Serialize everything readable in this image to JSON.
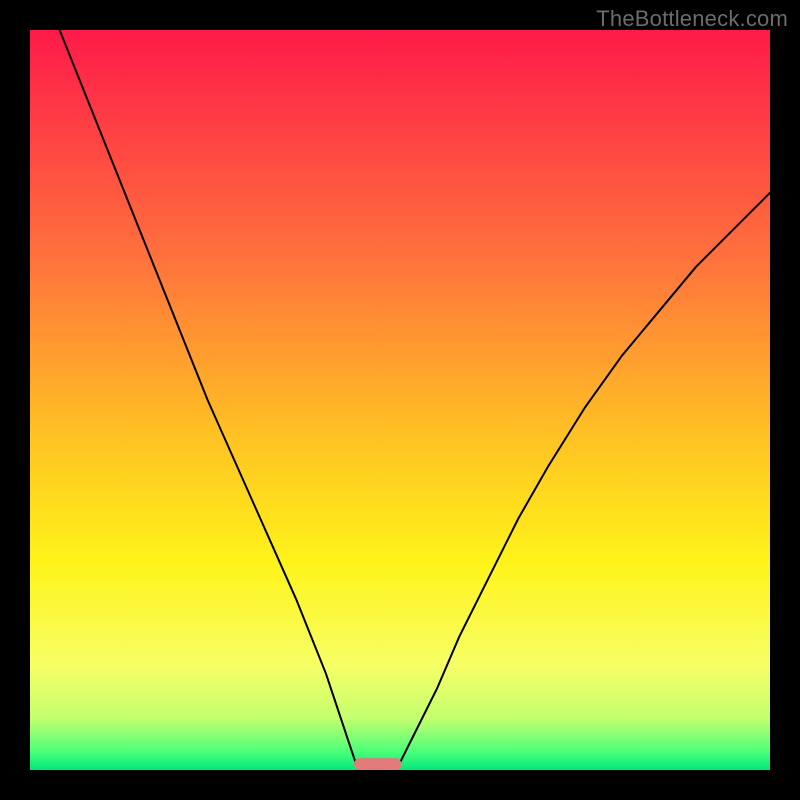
{
  "watermark": {
    "text": "TheBottleneck.com"
  },
  "colors": {
    "stroke": "#000000",
    "frame": "#000000",
    "marker_fill": "#e27b7a",
    "gradient_stops": [
      {
        "offset": 0.0,
        "color": "#ff1a49"
      },
      {
        "offset": 0.3,
        "color": "#ff6f3d"
      },
      {
        "offset": 0.55,
        "color": "#ffc223"
      },
      {
        "offset": 0.72,
        "color": "#fff31a"
      },
      {
        "offset": 0.86,
        "color": "#f6ff66"
      },
      {
        "offset": 0.93,
        "color": "#c4ff6e"
      },
      {
        "offset": 0.975,
        "color": "#4dff7a"
      },
      {
        "offset": 1.0,
        "color": "#00e87d"
      }
    ]
  },
  "chart_data": {
    "type": "line",
    "title": "",
    "xlabel": "",
    "ylabel": "",
    "xlim": [
      0,
      100
    ],
    "ylim": [
      0,
      100
    ],
    "series": [
      {
        "name": "left-curve",
        "x": [
          4,
          8,
          12,
          16,
          20,
          24,
          28,
          32,
          36,
          38,
          40,
          41,
          42,
          43,
          44
        ],
        "y": [
          100,
          90,
          80,
          70,
          60,
          50,
          41,
          32,
          23,
          18,
          13,
          10,
          7,
          4,
          1
        ]
      },
      {
        "name": "right-curve",
        "x": [
          50,
          52,
          55,
          58,
          62,
          66,
          70,
          75,
          80,
          85,
          90,
          95,
          100
        ],
        "y": [
          1,
          5,
          11,
          18,
          26,
          34,
          41,
          49,
          56,
          62,
          68,
          73,
          78
        ]
      }
    ],
    "marker": {
      "x_center": 47,
      "half_width": 3.2,
      "y": 0.8,
      "height": 1.6
    },
    "annotations": []
  }
}
